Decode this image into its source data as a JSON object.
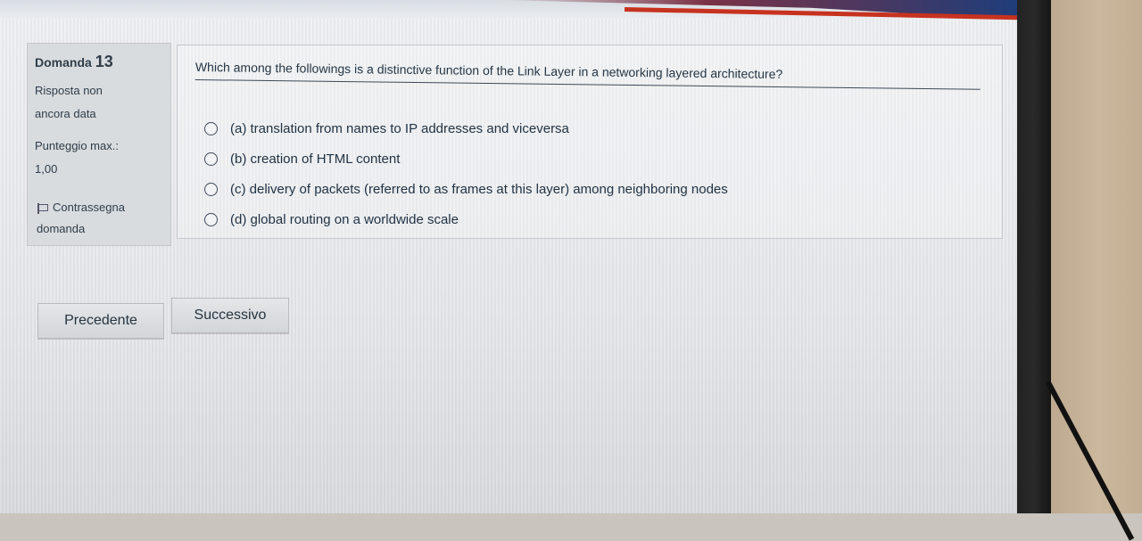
{
  "info": {
    "question_label": "Domanda",
    "question_number": "13",
    "status_line1": "Risposta non",
    "status_line2": "ancora data",
    "score_label": "Punteggio max.:",
    "score_value": "1,00",
    "flag_line1": "Contrassegna",
    "flag_line2": "domanda"
  },
  "question": {
    "text": "Which among the followings is a distinctive function of the Link Layer in a networking layered architecture?",
    "answers": [
      "(a) translation from names to IP addresses and viceversa",
      "(b) creation of HTML content",
      "(c) delivery of packets (referred to as frames at this layer) among neighboring nodes",
      "(d) global routing on a worldwide scale"
    ]
  },
  "nav": {
    "prev_label": "Precedente",
    "next_label": "Successivo"
  }
}
